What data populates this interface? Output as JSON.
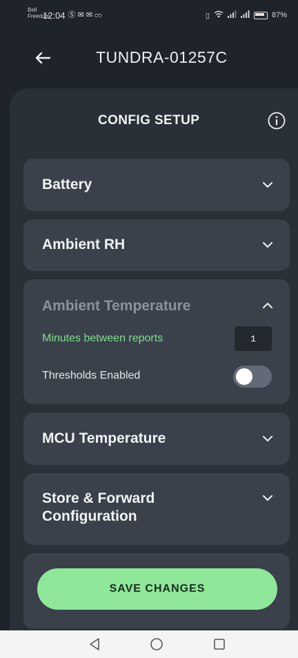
{
  "status_bar": {
    "carrier_line1": "Bell",
    "carrier_line2": "Freedom",
    "time": "12:04",
    "notification_icons": "Ⓢ ✉ ✉ တ",
    "battery_percent": "87%"
  },
  "app_bar": {
    "title": "TUNDRA-01257C",
    "back_icon": "arrow-left-icon"
  },
  "panel": {
    "title": "CONFIG SETUP",
    "info_icon": "info-icon"
  },
  "sections": [
    {
      "title": "Battery",
      "expanded": false
    },
    {
      "title": "Ambient RH",
      "expanded": false
    },
    {
      "title": "Ambient Temperature",
      "expanded": true,
      "settings": {
        "minutes_label": "Minutes between reports",
        "minutes_value": "1",
        "thresholds_label": "Thresholds Enabled",
        "thresholds_enabled": false
      }
    },
    {
      "title": "MCU Temperature",
      "expanded": false
    },
    {
      "title": "Store & Forward",
      "title_line2": "Configuration",
      "expanded": false
    }
  ],
  "save_button": {
    "label": "SAVE CHANGES"
  },
  "colors": {
    "background": "#1f232a",
    "panel": "#2a3038",
    "card": "#3a414b",
    "accent_green": "#8fe79a",
    "label_green": "#7fe08c"
  }
}
